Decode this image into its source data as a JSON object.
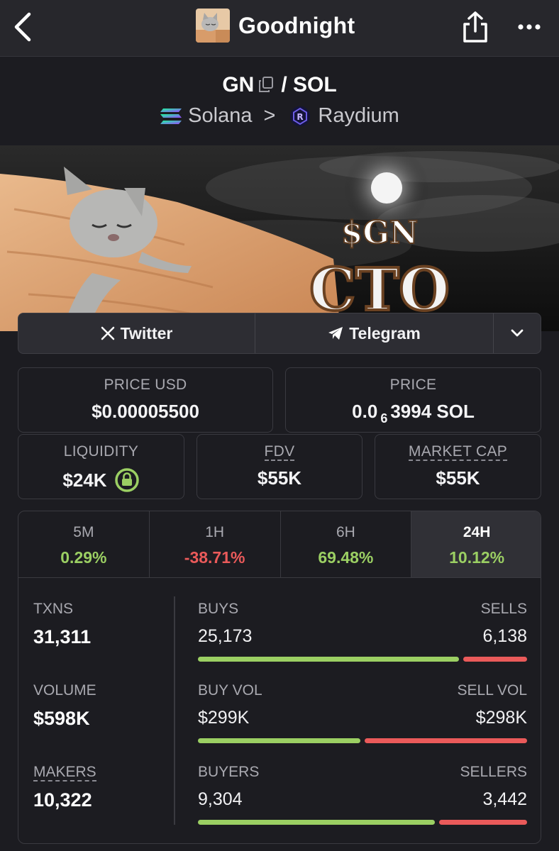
{
  "header": {
    "title": "Goodnight"
  },
  "pair": {
    "base": "GN",
    "separator": "/",
    "quote": "SOL",
    "chain": "Solana",
    "chain_sep": ">",
    "dex": "Raydium"
  },
  "banner": {
    "line1": "$GN",
    "line2": "CTO"
  },
  "social": {
    "twitter": "Twitter",
    "telegram": "Telegram"
  },
  "stats": {
    "price_usd_label": "PRICE USD",
    "price_usd": "$0.00005500",
    "price_label": "PRICE",
    "price_prefix": "0.0",
    "price_sub": "6",
    "price_suffix": "3994 SOL",
    "liquidity_label": "LIQUIDITY",
    "liquidity": "$24K",
    "fdv_label": "FDV",
    "fdv": "$55K",
    "mcap_label": "MARKET CAP",
    "mcap": "$55K"
  },
  "tabs": [
    {
      "label": "5M",
      "value": "0.29%",
      "trend": "up"
    },
    {
      "label": "1H",
      "value": "-38.71%",
      "trend": "down"
    },
    {
      "label": "6H",
      "value": "69.48%",
      "trend": "up"
    },
    {
      "label": "24H",
      "value": "10.12%",
      "trend": "up",
      "active": true
    }
  ],
  "metrics": {
    "txns_label": "TXNS",
    "txns": "31,311",
    "volume_label": "VOLUME",
    "volume": "$598K",
    "makers_label": "MAKERS",
    "makers": "10,322",
    "buys_label": "BUYS",
    "buys": "25,173",
    "sells_label": "SELLS",
    "sells": "6,138",
    "buyvol_label": "BUY VOL",
    "buyvol": "$299K",
    "sellvol_label": "SELL VOL",
    "sellvol": "$298K",
    "buyers_label": "BUYERS",
    "buyers": "9,304",
    "sellers_label": "SELLERS",
    "sellers": "3,442",
    "buys_ratio": 0.804,
    "buyvol_ratio": 0.501,
    "buyers_ratio": 0.73
  },
  "colors": {
    "up": "#9bcf63",
    "down": "#ea5a5a",
    "bg": "#1c1c21"
  }
}
